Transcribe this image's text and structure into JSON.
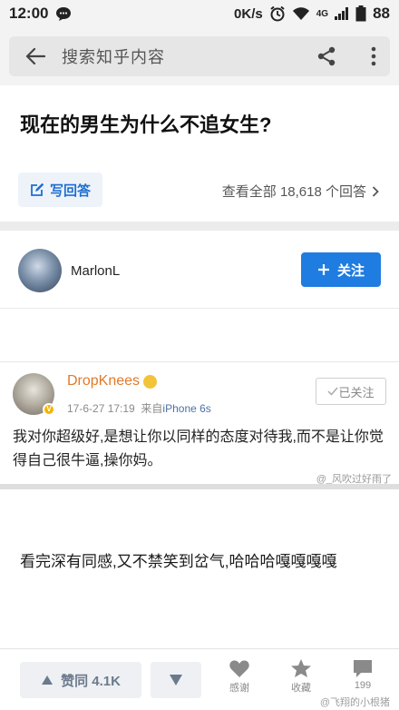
{
  "status_bar": {
    "time": "12:00",
    "speed": "0K/s",
    "network": "4G",
    "battery": "88"
  },
  "search": {
    "placeholder": "搜索知乎内容"
  },
  "question": {
    "title": "现在的男生为什么不追女生?",
    "write_answer_label": "写回答",
    "view_all_label": "查看全部 18,618 个回答"
  },
  "author": {
    "name": "MarlonL",
    "follow_label": "关注"
  },
  "embedded_post": {
    "username": "DropKnees",
    "time": "17-6-27 17:19",
    "source_prefix": "来自",
    "device": "iPhone 6s",
    "followed_label": "已关注",
    "text": "我对你超级好,是想让你以同样的态度对待我,而不是让你觉得自己很牛逼,操你妈。",
    "watermark": "@_风吹过好雨了"
  },
  "answer": {
    "text": "看完深有同感,又不禁笑到岔气,哈哈哈嘎嘎嘎嘎"
  },
  "bottom_bar": {
    "upvote_label": "赞同 4.1K",
    "thanks_label": "感谢",
    "collect_label": "收藏",
    "comment_count": "199",
    "watermark": "@飞翔的小根猪"
  },
  "colors": {
    "accent": "#1f7ce0",
    "link": "#1e6fd0",
    "embedded_username": "#e07a2b"
  }
}
